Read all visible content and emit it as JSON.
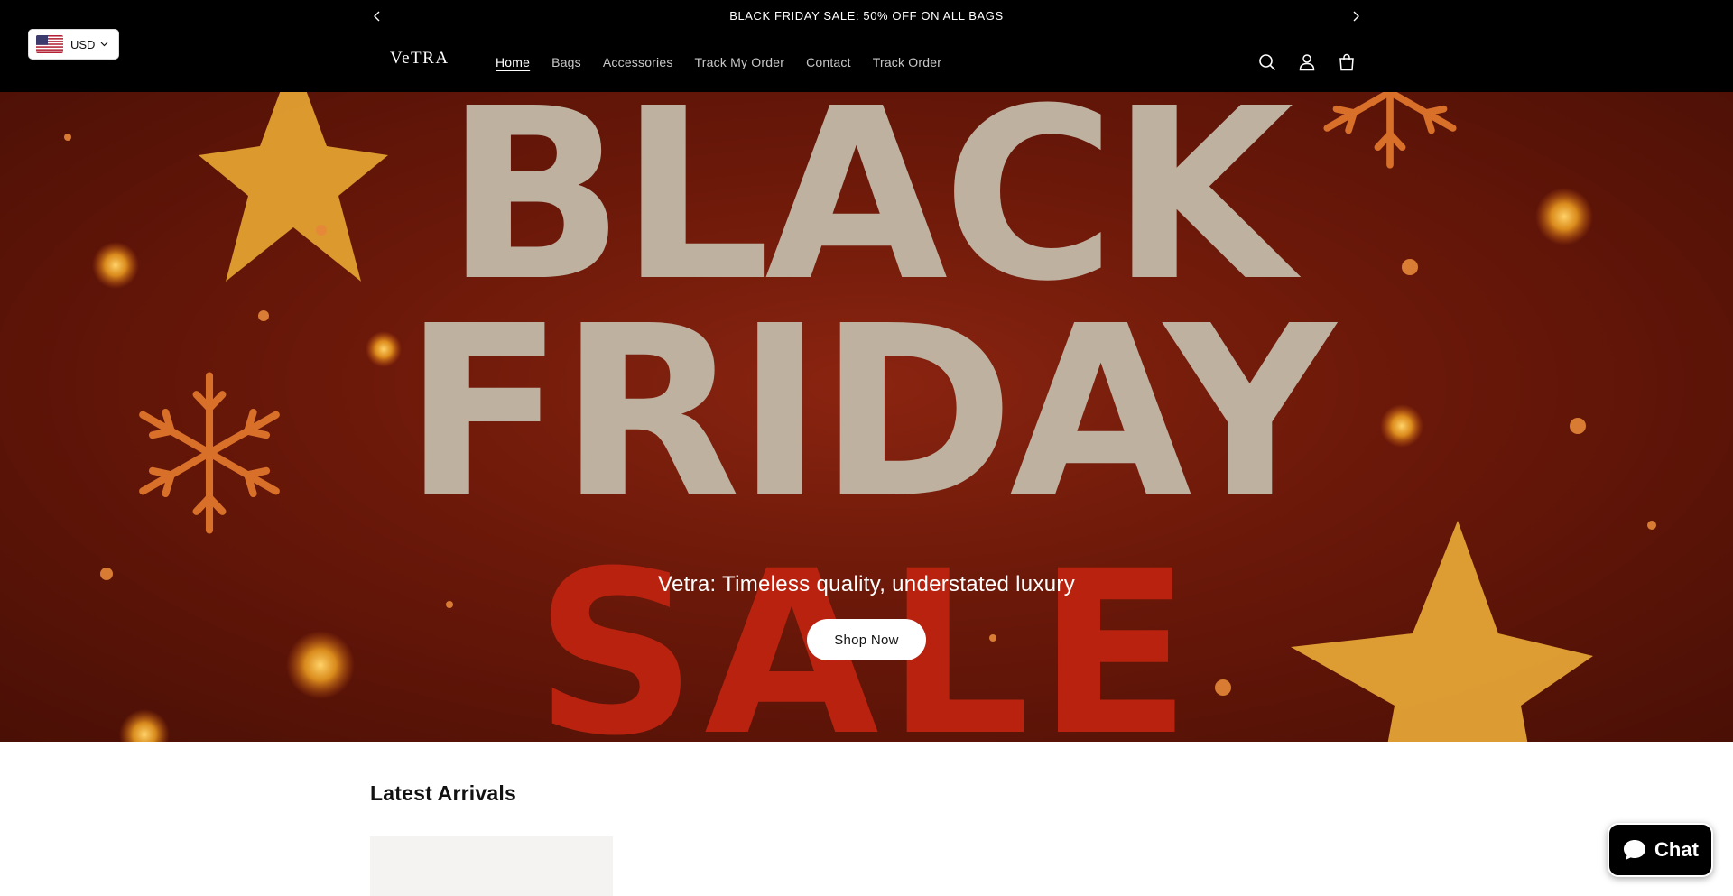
{
  "announcement": {
    "text": "BLACK FRIDAY SALE: 50% OFF ON ALL BAGS",
    "prev_icon": "chevron-left-icon",
    "next_icon": "chevron-right-icon"
  },
  "currency": {
    "code": "USD",
    "flag_icon": "us-flag-icon"
  },
  "header": {
    "logo": "VeTRA",
    "nav": [
      {
        "label": "Home",
        "active": true
      },
      {
        "label": "Bags",
        "active": false
      },
      {
        "label": "Accessories",
        "active": false
      },
      {
        "label": "Track My Order",
        "active": false
      },
      {
        "label": "Contact",
        "active": false
      },
      {
        "label": "Track Order",
        "active": false
      }
    ],
    "icons": [
      "search-icon",
      "account-icon",
      "cart-icon"
    ]
  },
  "hero": {
    "line1": "BLACK",
    "line2": "FRIDAY",
    "line3": "SALE",
    "tagline": "Vetra: Timeless quality, understated luxury",
    "button": "Shop Now",
    "colors": {
      "background": "#6a1809",
      "title": "#bfb1a0",
      "sale": "#b8220f"
    }
  },
  "latest": {
    "title": "Latest Arrivals"
  },
  "chat": {
    "label": "Chat",
    "icon": "chat-bubble-icon"
  }
}
